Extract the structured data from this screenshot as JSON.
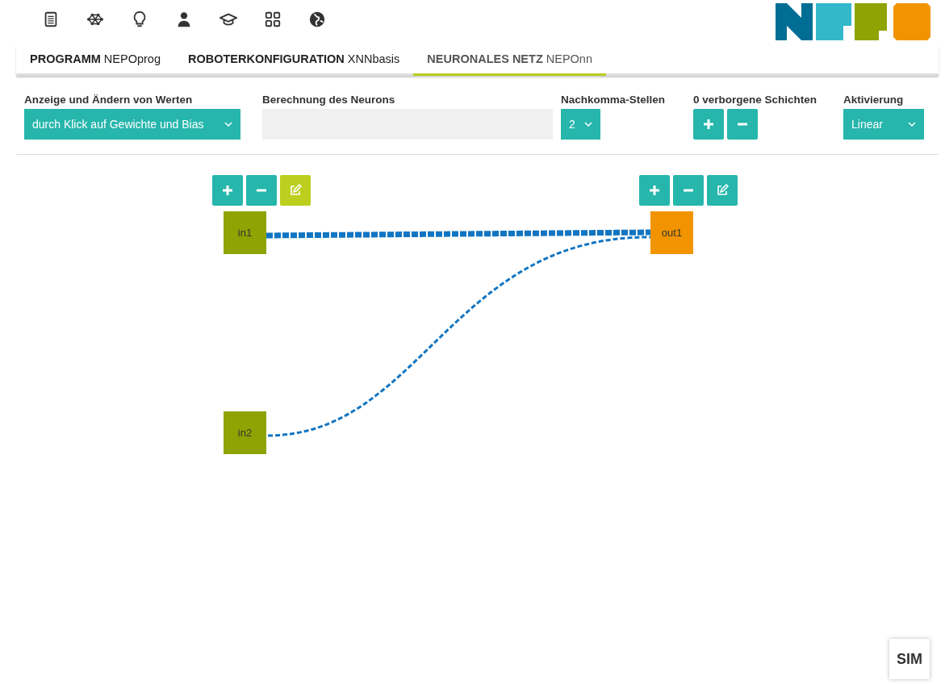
{
  "toolbar": {
    "icons": [
      {
        "kind": "document"
      },
      {
        "kind": "network"
      },
      {
        "kind": "bulb"
      },
      {
        "kind": "person"
      },
      {
        "kind": "cap"
      },
      {
        "kind": "grid"
      },
      {
        "kind": "globe"
      }
    ]
  },
  "tabs": [
    {
      "label": "**PROGRAMM** NEPOprog",
      "selected": false
    },
    {
      "label": "**ROBOTERKONFIGURATION** XNNbasis",
      "selected": false
    },
    {
      "label": "**NEURONALES NETZ** NEPOnn",
      "selected": true
    }
  ],
  "settings": {
    "display": {
      "label": "Anzeige und Ändern von Werten",
      "value": "durch Klick auf Gewichte und Bias"
    },
    "neuron_calc": {
      "label": "Berechnung des Neurons"
    },
    "decimals": {
      "label": "Nachkomma-Stellen",
      "value": "2"
    },
    "hidden_layers": {
      "label": "0 verborgene Schichten"
    },
    "activation": {
      "label": "Aktivierung",
      "value": "Linear"
    }
  },
  "input_layer": {
    "edit_selected": true,
    "neurons": [
      "in1",
      "in2"
    ]
  },
  "output_layer": {
    "edit_selected": false,
    "neurons": [
      "out1"
    ]
  },
  "sim_button": "SIM"
}
